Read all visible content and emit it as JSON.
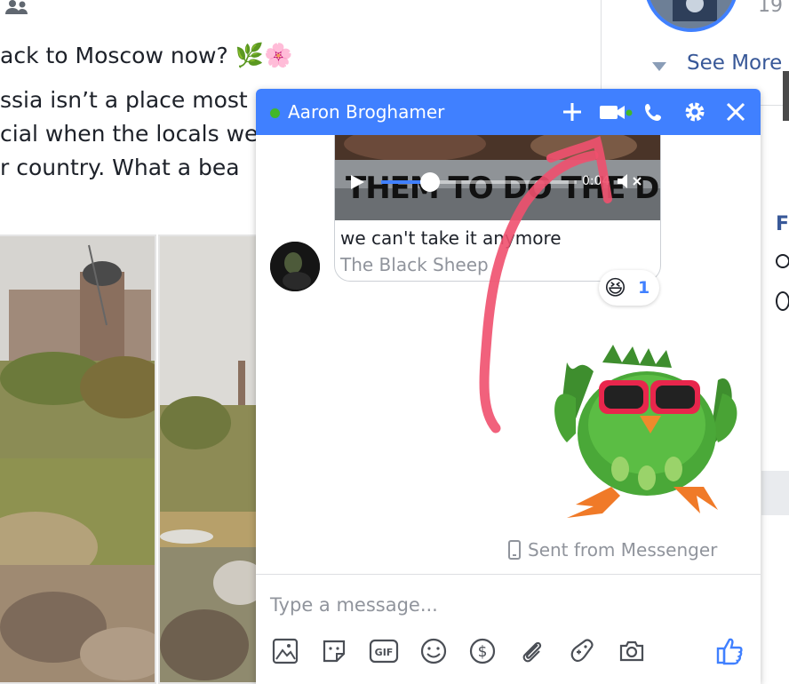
{
  "feed": {
    "line1": "ack to Moscow now?",
    "line2": "ssia isn’t a place most",
    "line3": "cial when the locals we",
    "line4": "r country. What a bea"
  },
  "sidebar": {
    "count": "19",
    "see_more": "See More",
    "initial": "F"
  },
  "chat": {
    "contact_name": "Aaron Broghamer",
    "online_color": "#42b72a",
    "header_color": "#4080ff",
    "video": {
      "overlay_text": "THEM TO DO THE DISHES",
      "time": "0:04",
      "progress_fraction": 0.25
    },
    "shared_link": {
      "title": "we can't take it anymore",
      "source": "The Black Sheep"
    },
    "reaction": {
      "emoji": "😆",
      "count": "1"
    },
    "sent_from": "Sent from Messenger",
    "composer_placeholder": "Type a message...",
    "composer_icons": [
      "photo-icon",
      "sticker-icon",
      "gif-icon",
      "emoji-icon",
      "payment-icon",
      "attachment-icon",
      "games-icon",
      "camera-icon"
    ],
    "like_color": "#4080ff",
    "annotation_color": "#f0506e"
  }
}
